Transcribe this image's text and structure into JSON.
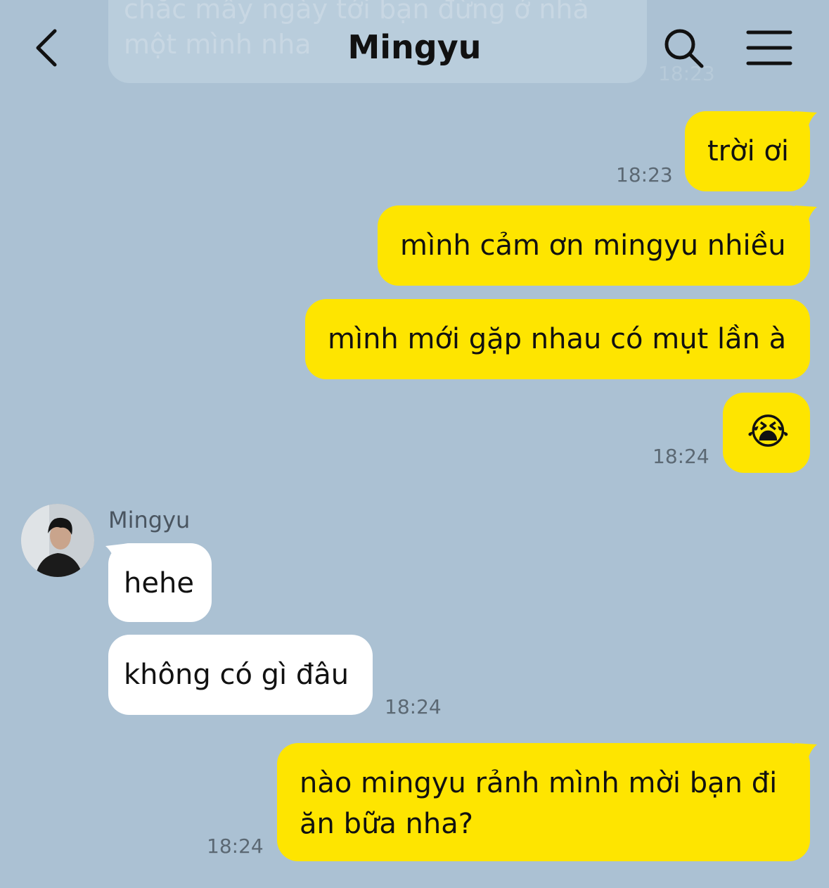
{
  "header": {
    "title": "Mingyu"
  },
  "previous_message": {
    "line1": "chắc mấy ngày tới bạn đừng ở nhà",
    "line2": "một mình nha",
    "time": "18:23"
  },
  "messages": [
    {
      "direction": "out",
      "text": "trời ơi",
      "time": "18:23"
    },
    {
      "direction": "out",
      "text": "mình cảm ơn mingyu nhiều",
      "time": ""
    },
    {
      "direction": "out",
      "text": "mình mới gặp nhau có mụt lần à",
      "time": ""
    },
    {
      "direction": "out",
      "emoji": "😭",
      "time": "18:24"
    },
    {
      "direction": "in",
      "sender": "Mingyu",
      "text": "hehe",
      "time": ""
    },
    {
      "direction": "in",
      "text": "không có gì đâu",
      "time": "18:24"
    },
    {
      "direction": "out",
      "line1": "nào mingyu rảnh mình mời bạn đi",
      "line2": "ăn bữa nha?",
      "time": "18:24"
    }
  ],
  "icons": {
    "back": "chevron-left-icon",
    "search": "search-icon",
    "menu": "hamburger-menu-icon",
    "avatar": "avatar"
  },
  "colors": {
    "background": "#abc1d3",
    "outgoing_bubble": "#fee500",
    "incoming_bubble": "#ffffff",
    "timestamp": "#5b6873"
  }
}
